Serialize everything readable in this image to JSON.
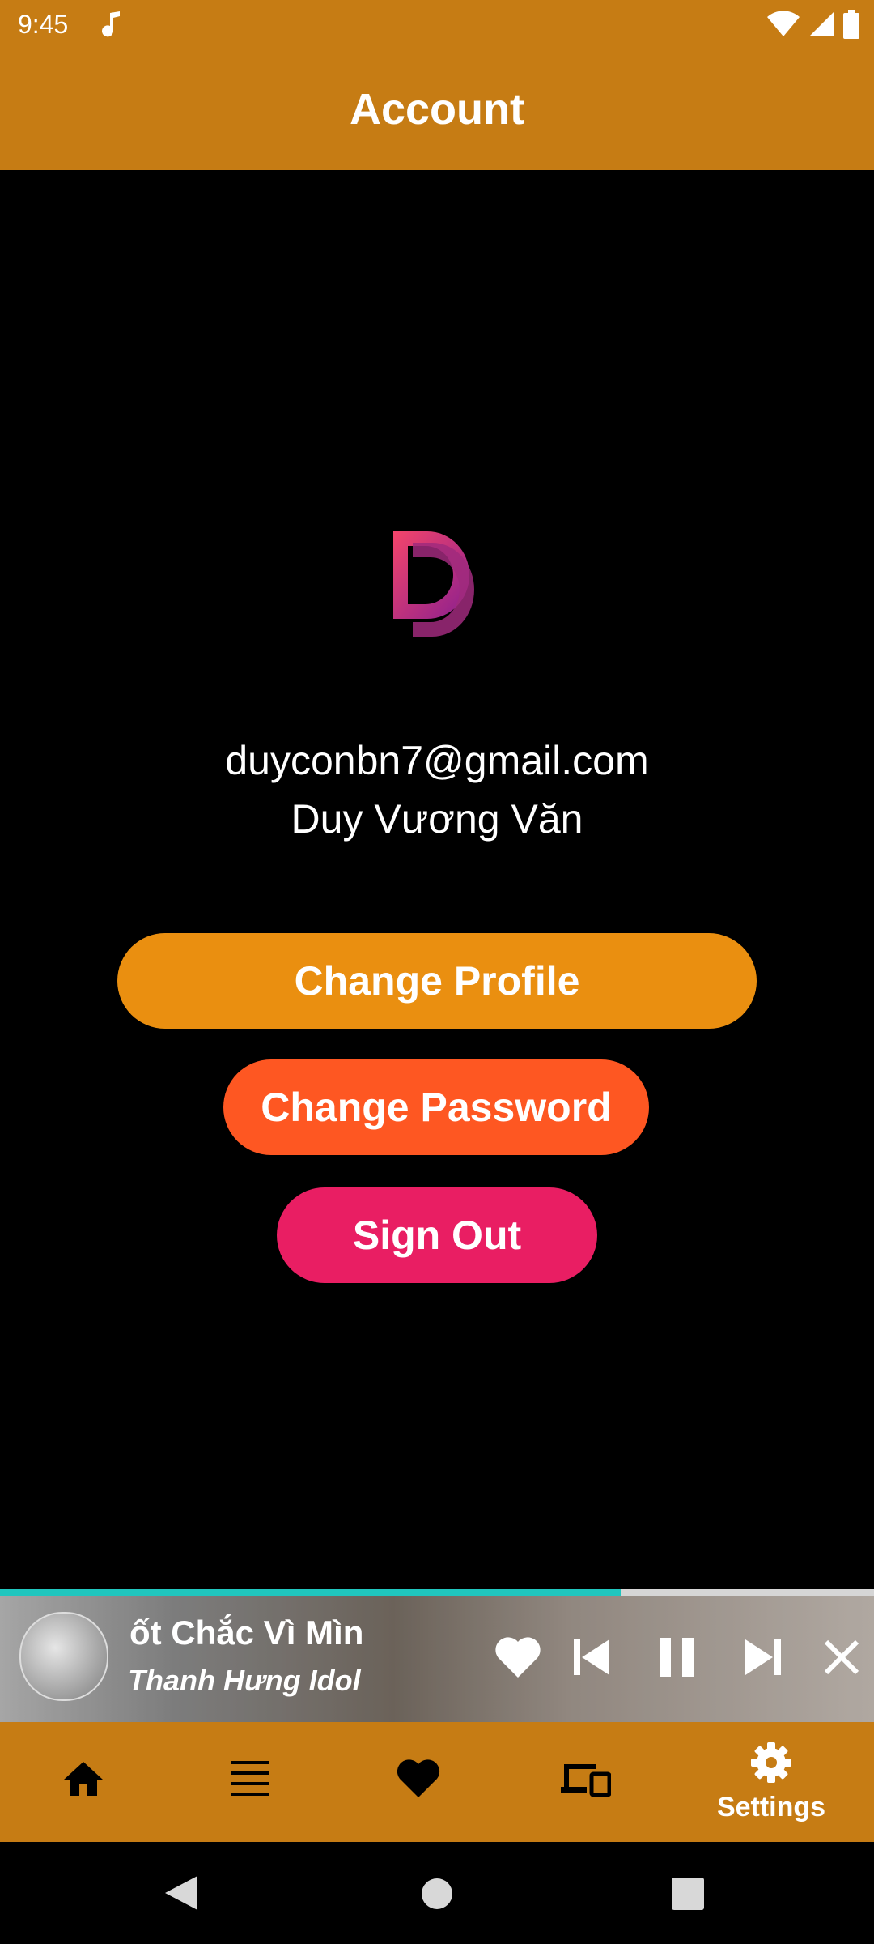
{
  "status": {
    "time": "9:45"
  },
  "header": {
    "title": "Account"
  },
  "profile": {
    "email": "duyconbn7@gmail.com",
    "name": "Duy Vương Văn"
  },
  "actions": {
    "change_profile": "Change Profile",
    "change_password": "Change Password",
    "sign_out": "Sign Out"
  },
  "player": {
    "title": "ốt        Chắc Vì Mìn",
    "artist": "Thanh Hưng Idol",
    "progress_percent": 71,
    "state": "playing"
  },
  "bottom_nav": {
    "items": [
      {
        "icon": "home-icon",
        "label": ""
      },
      {
        "icon": "list-icon",
        "label": ""
      },
      {
        "icon": "heart-icon",
        "label": ""
      },
      {
        "icon": "devices-icon",
        "label": ""
      },
      {
        "icon": "settings-icon",
        "label": "Settings"
      }
    ],
    "active_index": 4
  },
  "colors": {
    "accent": "#c67c14",
    "change_profile": "#ea8f10",
    "change_password": "#fe5722",
    "sign_out": "#e91e63",
    "progress": "#20c6be"
  }
}
